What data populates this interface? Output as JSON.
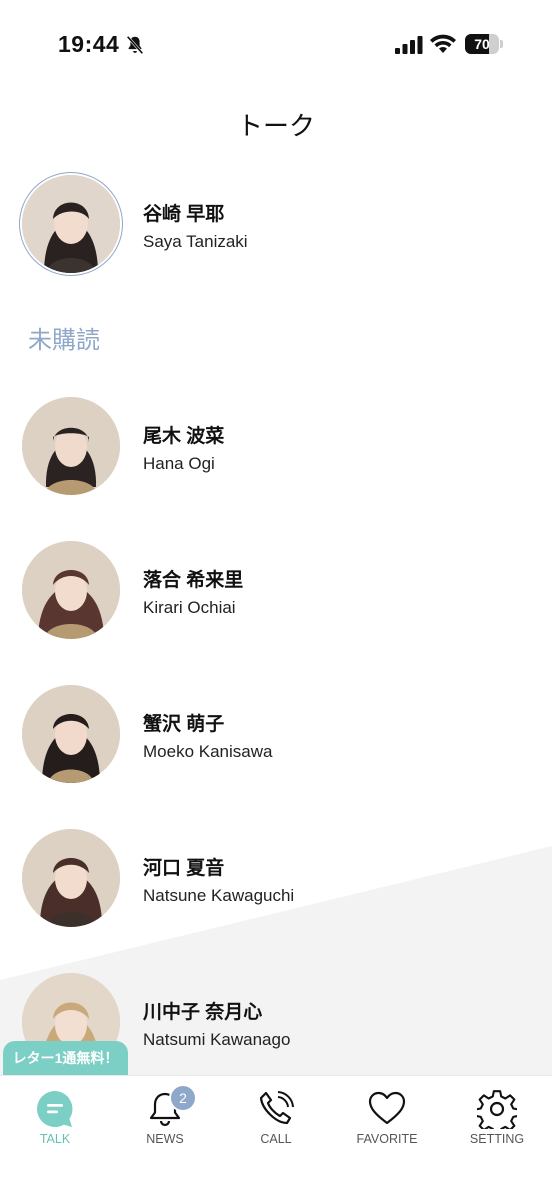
{
  "status_bar": {
    "time": "19:44",
    "battery": "70",
    "battery_level": 0.7
  },
  "header": {
    "title": "トーク"
  },
  "pinned": {
    "name_jp": "谷崎 早耶",
    "name_en": "Saya Tanizaki"
  },
  "section": {
    "label": "未購読"
  },
  "members": [
    {
      "name_jp": "尾木 波菜",
      "name_en": "Hana Ogi"
    },
    {
      "name_jp": "落合 希来里",
      "name_en": "Kirari Ochiai"
    },
    {
      "name_jp": "蟹沢 萌子",
      "name_en": "Moeko Kanisawa"
    },
    {
      "name_jp": "河口 夏音",
      "name_en": "Natsune Kawaguchi"
    },
    {
      "name_jp": "川中子 奈月心",
      "name_en": "Natsumi Kawanago"
    }
  ],
  "promo": {
    "text": "レター1通無料！"
  },
  "tabs": [
    {
      "label": "TALK",
      "icon": "talk-bubble-icon",
      "active": true
    },
    {
      "label": "NEWS",
      "icon": "bell-icon",
      "badge": "2"
    },
    {
      "label": "CALL",
      "icon": "phone-icon"
    },
    {
      "label": "FAVORITE",
      "icon": "heart-icon"
    },
    {
      "label": "SETTING",
      "icon": "gear-icon"
    }
  ],
  "colors": {
    "accent_teal": "#64c1b6",
    "section_blue": "#8fa8c9",
    "badge_blue": "#8fa8c9"
  }
}
